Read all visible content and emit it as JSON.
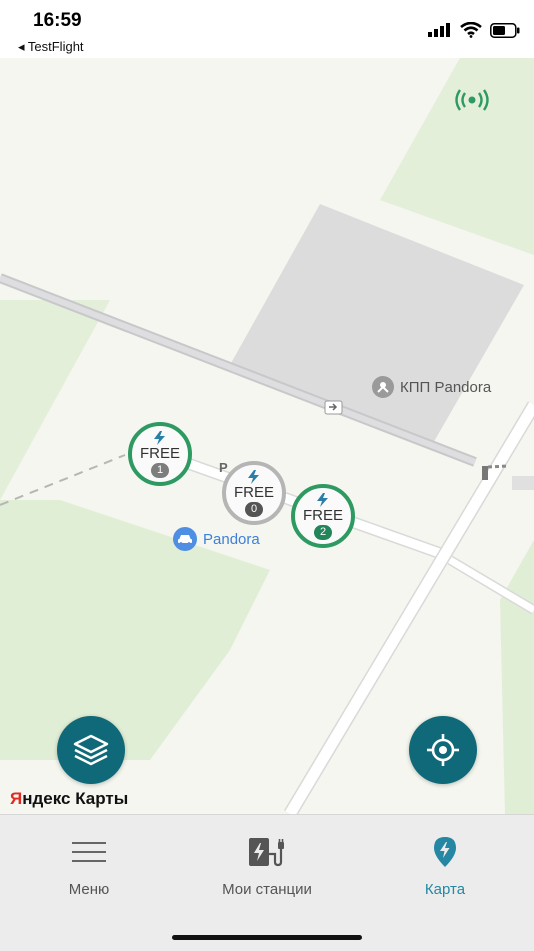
{
  "status_bar": {
    "time": "16:59",
    "back_label": "◂ TestFlight",
    "icons": [
      "cellular-signal-icon",
      "wifi-icon",
      "battery-icon"
    ]
  },
  "map": {
    "pois": {
      "kpp": "КПП Pandora",
      "pandora": "Pandora",
      "parking_letter": "P"
    },
    "stations": [
      {
        "label": "FREE",
        "count": "1",
        "status": "green"
      },
      {
        "label": "FREE",
        "count": "0",
        "status": "gray"
      },
      {
        "label": "FREE",
        "count": "2",
        "status": "green"
      }
    ],
    "attribution": {
      "y": "Я",
      "rest": "ндекс Карты"
    },
    "buttons": [
      "layers-button",
      "locate-button"
    ],
    "colors": {
      "accent": "#0f6978",
      "station_free": "#2e9a62",
      "station_offline": "#b5b5b5"
    }
  },
  "tabbar": {
    "tabs": [
      {
        "label": "Меню",
        "icon": "menu-icon",
        "active": false
      },
      {
        "label": "Мои станции",
        "icon": "charging-station-icon",
        "active": false
      },
      {
        "label": "Карта",
        "icon": "map-pin-icon",
        "active": true
      }
    ],
    "active_color": "#2587a3"
  }
}
